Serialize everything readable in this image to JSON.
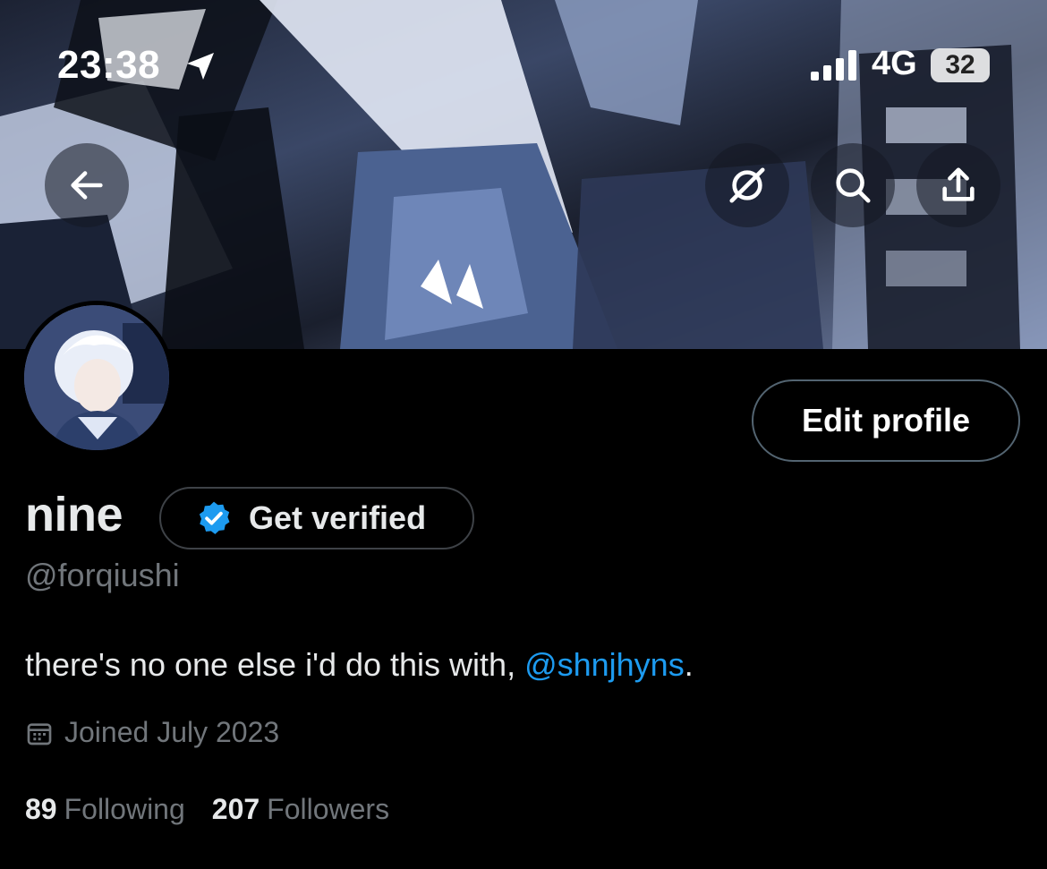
{
  "status_bar": {
    "time": "23:38",
    "network": "4G",
    "battery": "32"
  },
  "nav": {
    "back_icon": "arrow-left-icon",
    "grok_icon": "grok-icon",
    "search_icon": "search-icon",
    "share_icon": "share-icon"
  },
  "profile": {
    "display_name": "nine",
    "handle": "@forqiushi",
    "edit_label": "Edit profile",
    "verify_label": "Get verified",
    "bio_text": "there's no one else i'd do this with, ",
    "bio_mention": "@shnjhyns",
    "bio_suffix": ".",
    "joined": "Joined July 2023",
    "following_count": "89",
    "following_label": "Following",
    "followers_count": "207",
    "followers_label": "Followers"
  },
  "colors": {
    "background": "#000000",
    "accent": "#1d9bf0",
    "muted": "#71767b",
    "text": "#e7e9ea"
  }
}
